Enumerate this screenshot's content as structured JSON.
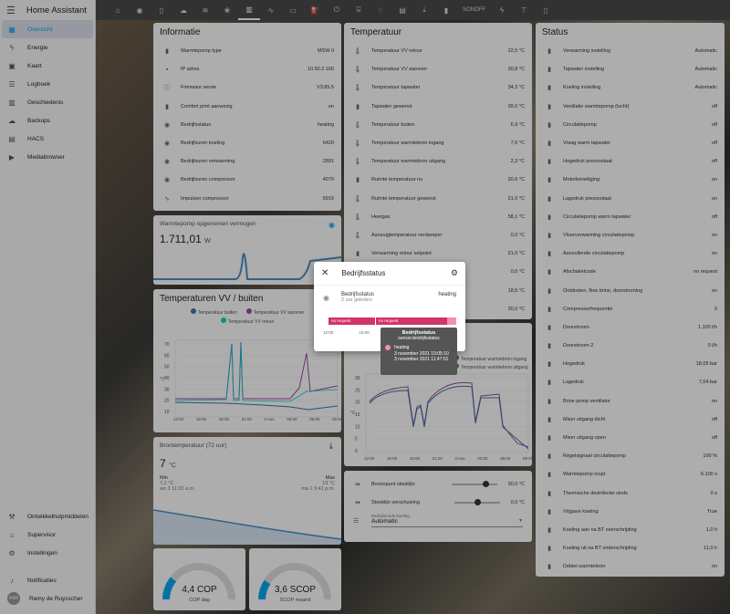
{
  "app_title": "Home Assistant",
  "sidebar": {
    "items": [
      {
        "label": "Overzicht",
        "icon": "dashboard-icon",
        "glyph": "▦"
      },
      {
        "label": "Energie",
        "icon": "lightning-icon",
        "glyph": "ϟ"
      },
      {
        "label": "Kaart",
        "icon": "map-icon",
        "glyph": "▣"
      },
      {
        "label": "Logboek",
        "icon": "list-icon",
        "glyph": "☰"
      },
      {
        "label": "Geschiedenis",
        "icon": "chart-icon",
        "glyph": "▥"
      },
      {
        "label": "Backups",
        "icon": "cloud-icon",
        "glyph": "☁"
      },
      {
        "label": "HACS",
        "icon": "hacs-icon",
        "glyph": "▤"
      },
      {
        "label": "Mediabrowser",
        "icon": "media-icon",
        "glyph": "▶"
      }
    ],
    "bottom": [
      {
        "label": "Ontwikkelhulpmiddelen",
        "icon": "hammer-icon",
        "glyph": "⚒"
      },
      {
        "label": "Supervisor",
        "icon": "supervisor-icon",
        "glyph": "⌂"
      },
      {
        "label": "Instellingen",
        "icon": "cog-icon",
        "glyph": "⚙"
      },
      {
        "label": "Notificaties",
        "icon": "bell-icon",
        "glyph": "♪"
      }
    ],
    "user": {
      "initials": "RdR",
      "name": "Remy de Ruysscher"
    }
  },
  "topbar": {
    "sonoff_label": "SONOFF"
  },
  "info": {
    "title": "Informatie",
    "rows": [
      {
        "label": "Warmtepomp type",
        "value": "MSW II"
      },
      {
        "label": "IP adres",
        "value": "10.50.2.160"
      },
      {
        "label": "Firmware versie",
        "value": "V3.85.5"
      },
      {
        "label": "Comfort print aanwezig",
        "value": "on"
      },
      {
        "label": "Bedrijfsstatus",
        "value": "heating"
      },
      {
        "label": "Bedrijfsuren koeling",
        "value": "6420"
      },
      {
        "label": "Bedrijfsuren verwarming",
        "value": "2891"
      },
      {
        "label": "Bedrijfsuren compressor",
        "value": "4079"
      },
      {
        "label": "Impulsen compressor",
        "value": "5919"
      }
    ]
  },
  "power": {
    "title": "Warmtepomp opgenomen vermogen",
    "value": "1.711,01",
    "unit": "W"
  },
  "tempchart": {
    "title": "Temperaturen VV / buiten",
    "legend": [
      "Temperatuur buiten",
      "Temperatuur VV aanvoer",
      "Temperatuur VV retour"
    ],
    "yticks": [
      "70",
      "60",
      "50",
      "40",
      "30",
      "20",
      "10"
    ],
    "xticks": [
      "12:00",
      "15:00",
      "18:00",
      "21:00",
      "3 nov.",
      "03:00",
      "06:00",
      "09:00"
    ],
    "ylabel": "°C"
  },
  "bron": {
    "title": "Brontemperatuur (72 uur)",
    "value": "7",
    "unit": "°C",
    "min_label": "Min",
    "min_value": "7,2 °C",
    "min_time": "wo 3 11:32 a.m.",
    "max_label": "Max",
    "max_value": "19 °C",
    "max_time": "ma 1 9:41 p.m."
  },
  "cop": {
    "value": "4,4 COP",
    "label": "COP dag"
  },
  "scop": {
    "value": "3,6 SCOP",
    "label": "SCOP maand"
  },
  "temp": {
    "title": "Temperatuur",
    "rows": [
      {
        "label": "Temperatuur VV retour",
        "value": "22,5 °C"
      },
      {
        "label": "Temperatuur VV aanvoer",
        "value": "30,8 °C"
      },
      {
        "label": "Temperatuur tapwater",
        "value": "34,3 °C"
      },
      {
        "label": "Tapwater gewenst",
        "value": "39,0 °C"
      },
      {
        "label": "Temperatuur buiten",
        "value": "6,9 °C"
      },
      {
        "label": "Temperatuur warmtebron ingang",
        "value": "7,0 °C"
      },
      {
        "label": "Temperatuur warmtebron uitgang",
        "value": "2,3 °C"
      },
      {
        "label": "Ruimte temperatuur nu",
        "value": "20,6 °C"
      },
      {
        "label": "Ruimte temperatuur gewenst",
        "value": "21,0 °C"
      },
      {
        "label": "Heetgas",
        "value": "58,1 °C"
      },
      {
        "label": "Aanzuigtemperatuur verdamper",
        "value": "0,0 °C"
      },
      {
        "label": "Verwarming retour setpoint",
        "value": "21,0 °C"
      },
      {
        "label": "",
        "value": "0,0 °C"
      },
      {
        "label": "",
        "value": "18,5 °C"
      },
      {
        "label": "",
        "value": "20,0 °C"
      }
    ]
  },
  "bronchart": {
    "legend": [
      "Temperatuur warmtebron ingang",
      "Temperatuur warmtebron uitgang"
    ],
    "yticks": [
      "30",
      "25",
      "20",
      "15",
      "10",
      "5",
      "0"
    ],
    "xticks": [
      "12:00",
      "15:00",
      "18:00",
      "21:00",
      "3 nov.",
      "03:00",
      "06:00",
      "09:00"
    ],
    "ylabel": "°C"
  },
  "controls": {
    "rows": [
      {
        "label": "Bovenpunt stooklijn",
        "value": "30,0 °C"
      },
      {
        "label": "Stooklijn verschuiving",
        "value": "0,0 °C"
      }
    ],
    "select_label": "Bedrijfsmode koeling",
    "select_value": "Automatic"
  },
  "status": {
    "title": "Status",
    "rows": [
      {
        "label": "Verwarming instelling",
        "value": "Automatic"
      },
      {
        "label": "Tapwater instelling",
        "value": "Automatic"
      },
      {
        "label": "Koeling instelling",
        "value": "Automatic"
      },
      {
        "label": "Ventilatie warmtepomp (lucht)",
        "value": "off"
      },
      {
        "label": "Circulatiepomp",
        "value": "off"
      },
      {
        "label": "Vraag warm tapwater",
        "value": "off"
      },
      {
        "label": "Hogedruk pressostaat",
        "value": "off"
      },
      {
        "label": "Motorbeveiliging",
        "value": "on"
      },
      {
        "label": "Lagedruk pressostaat",
        "value": "on"
      },
      {
        "label": "Circulatiepomp warm tapwater",
        "value": "off"
      },
      {
        "label": "Vloerverwarming circulatiepomp",
        "value": "on"
      },
      {
        "label": "Aanvullende circulatiepomp",
        "value": "on"
      },
      {
        "label": "Afschakelcode",
        "value": "no request"
      },
      {
        "label": "Ontdooien, flow brine, doorstroming",
        "value": "on"
      },
      {
        "label": "Compressorfrequentie",
        "value": "0"
      },
      {
        "label": "Doorstroom",
        "value": "1.100 l/h"
      },
      {
        "label": "Doorstroom 2",
        "value": "0 l/h"
      },
      {
        "label": "Hogedruk",
        "value": "18,05 bar"
      },
      {
        "label": "Lagedruk",
        "value": "7,04 bar"
      },
      {
        "label": "Brine pomp ventilator",
        "value": "on"
      },
      {
        "label": "Mixer uitgang dicht",
        "value": "off"
      },
      {
        "label": "Mixer uitgang open",
        "value": "off"
      },
      {
        "label": "Regelsignaal circulatiepomp",
        "value": "100 %"
      },
      {
        "label": "Warmtepomp loopt",
        "value": "6.100 s"
      },
      {
        "label": "Thermische desinfectie sinds",
        "value": "0 s"
      },
      {
        "label": "Vrijgave koeling",
        "value": "True"
      },
      {
        "label": "Koeling aan na BT overschrijding",
        "value": "1,0 h"
      },
      {
        "label": "Koeling uit na BT onderschrijding",
        "value": "11,0 h"
      },
      {
        "label": "Debiet warmtebron",
        "value": "on"
      }
    ]
  },
  "dialog": {
    "title": "Bedrijfsstatus",
    "entity": "Bedrijfsstatus",
    "ago": "2 uur geleden",
    "state": "heating",
    "bar_labels": [
      "no request",
      "no request"
    ],
    "xticks": [
      "12:00",
      "15:00",
      "20:00"
    ]
  },
  "tooltip": {
    "title": "Bedrijfsstatus",
    "subtitle": "sensor.bedrijfsstatus",
    "state": "heating",
    "from": "3 november 2021 10:05:10",
    "to": "3 november 2021 11:47:01"
  }
}
